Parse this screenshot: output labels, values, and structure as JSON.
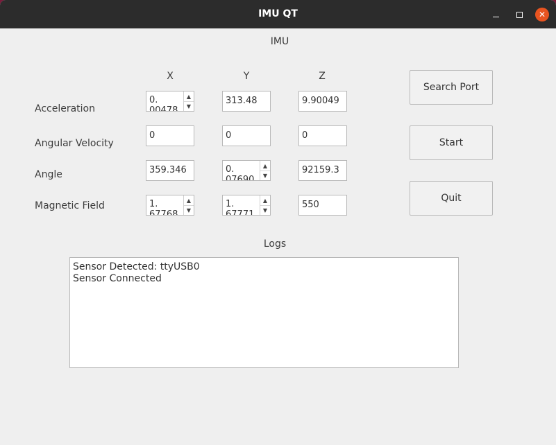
{
  "window": {
    "title": "IMU QT"
  },
  "header": {
    "imu_label": "IMU"
  },
  "columns": [
    "X",
    "Y",
    "Z"
  ],
  "rows": [
    {
      "label": "Acceleration",
      "x": "0.\n00478",
      "y": "313.48",
      "z": "9.90049"
    },
    {
      "label": "Angular Velocity",
      "x": "0",
      "y": "0",
      "z": "0"
    },
    {
      "label": "Angle",
      "x": "359.346",
      "y": "0.\n07690",
      "z": "92159.3"
    },
    {
      "label": "Magnetic Field",
      "x": "1.\n67768",
      "y": "1.\n67771",
      "z": "550"
    }
  ],
  "buttons": {
    "search_port": "Search Port",
    "start": "Start",
    "quit": "Quit"
  },
  "logs": {
    "label": "Logs",
    "lines": [
      "Sensor Detected: ttyUSB0",
      "Sensor Connected"
    ]
  },
  "colors": {
    "titlebar": "#2c2c2c",
    "close_button": "#e95420",
    "background": "#efefef"
  }
}
